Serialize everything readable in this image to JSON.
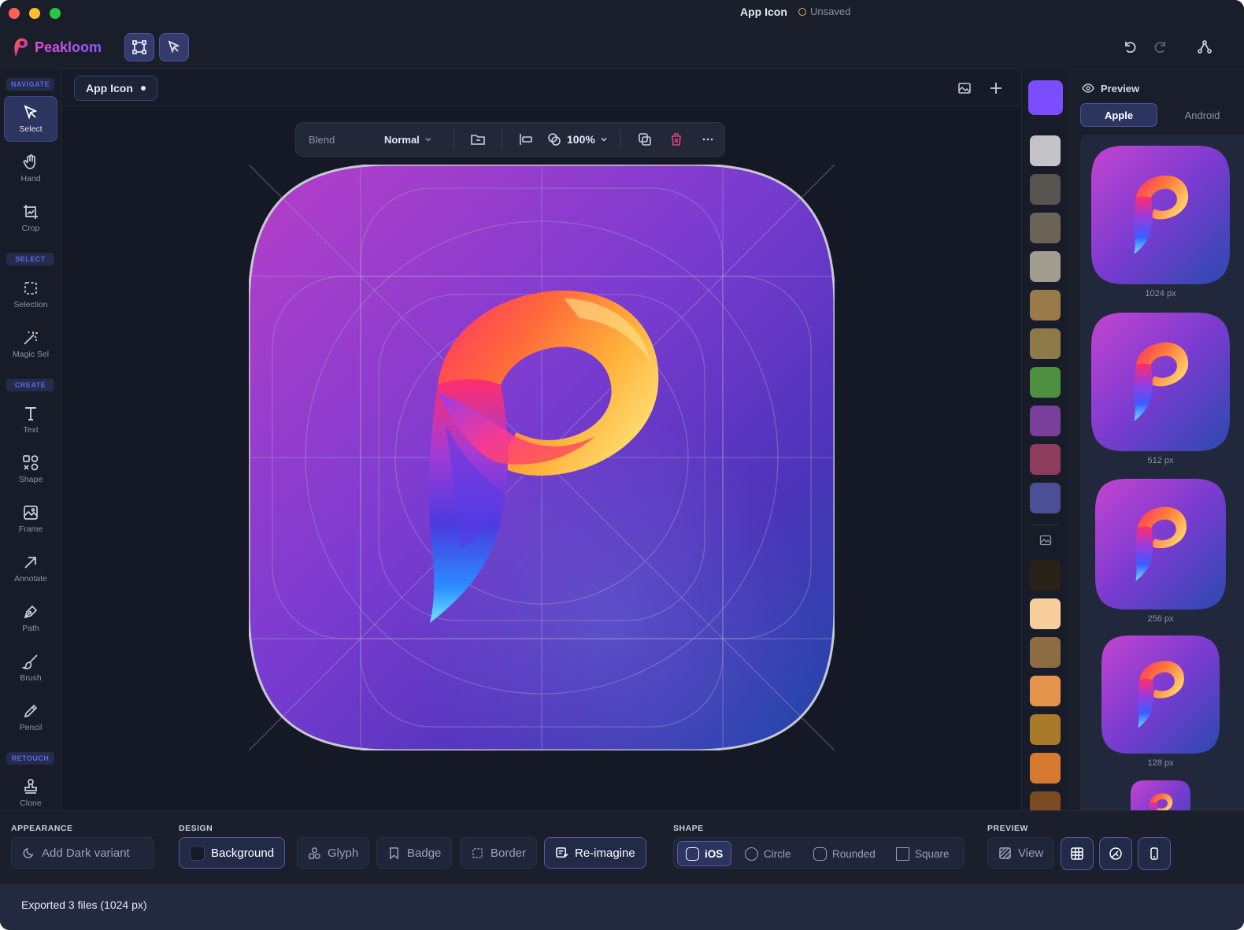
{
  "window": {
    "title": "App Icon",
    "status": "Unsaved"
  },
  "app": {
    "name": "Peakloom"
  },
  "sidebar": {
    "sections": [
      {
        "label": "NAVIGATE"
      },
      {
        "label": "SELECT"
      },
      {
        "label": "CREATE"
      },
      {
        "label": "RETOUCH"
      }
    ],
    "tools": [
      {
        "label": "Select",
        "icon": "cursor-icon",
        "active": true
      },
      {
        "label": "Hand",
        "icon": "hand-icon"
      },
      {
        "label": "Crop",
        "icon": "crop-icon"
      },
      {
        "label": "Selection",
        "icon": "selection-icon"
      },
      {
        "label": "Magic Sel",
        "icon": "magic-wand-icon"
      },
      {
        "label": "Text",
        "icon": "text-icon"
      },
      {
        "label": "Shape",
        "icon": "shapes-icon"
      },
      {
        "label": "Frame",
        "icon": "frame-icon"
      },
      {
        "label": "Annotate",
        "icon": "arrow-icon"
      },
      {
        "label": "Path",
        "icon": "pen-icon"
      },
      {
        "label": "Brush",
        "icon": "brush-icon"
      },
      {
        "label": "Pencil",
        "icon": "pencil-icon"
      },
      {
        "label": "Clone",
        "icon": "stamp-icon"
      }
    ]
  },
  "canvas": {
    "doc_tab": "App Icon",
    "floatbar": {
      "blend_label": "Blend",
      "blend_value": "Normal",
      "opacity": "100%"
    }
  },
  "swatches": {
    "current": "#7b4dff",
    "group1": [
      "#c4c4c8",
      "#57534f",
      "#6b6358",
      "#a39c90",
      "#9a7a4a",
      "#8e7a49",
      "#4d8f3f",
      "#7a3f9a",
      "#8e3c5c",
      "#4b4f96"
    ],
    "group2": [
      "#2a2218",
      "#f7cf9c",
      "#8e6c43",
      "#e4944a",
      "#a97a2c",
      "#d67a32",
      "#7a4a22"
    ]
  },
  "preview": {
    "title": "Preview",
    "tabs": [
      "Apple",
      "Android"
    ],
    "sizes": [
      "1024 px",
      "512 px",
      "256 px",
      "128 px"
    ]
  },
  "bottombar": {
    "appearance": {
      "label": "APPEARANCE",
      "add_dark": "Add Dark variant"
    },
    "design": {
      "label": "DESIGN",
      "background": "Background",
      "glyph": "Glyph",
      "badge": "Badge",
      "border": "Border",
      "reimagine": "Re-imagine"
    },
    "shape": {
      "label": "SHAPE",
      "options": [
        "iOS",
        "Circle",
        "Rounded",
        "Square"
      ]
    },
    "preview": {
      "label": "PREVIEW",
      "view": "View"
    }
  },
  "status": {
    "text": "Exported 3 files (1024 px)"
  },
  "colors": {
    "accent": "#4f5ba6",
    "background": "#161a26",
    "brand_pink": "#e84bd2",
    "brand_purple": "#8a5bff"
  }
}
